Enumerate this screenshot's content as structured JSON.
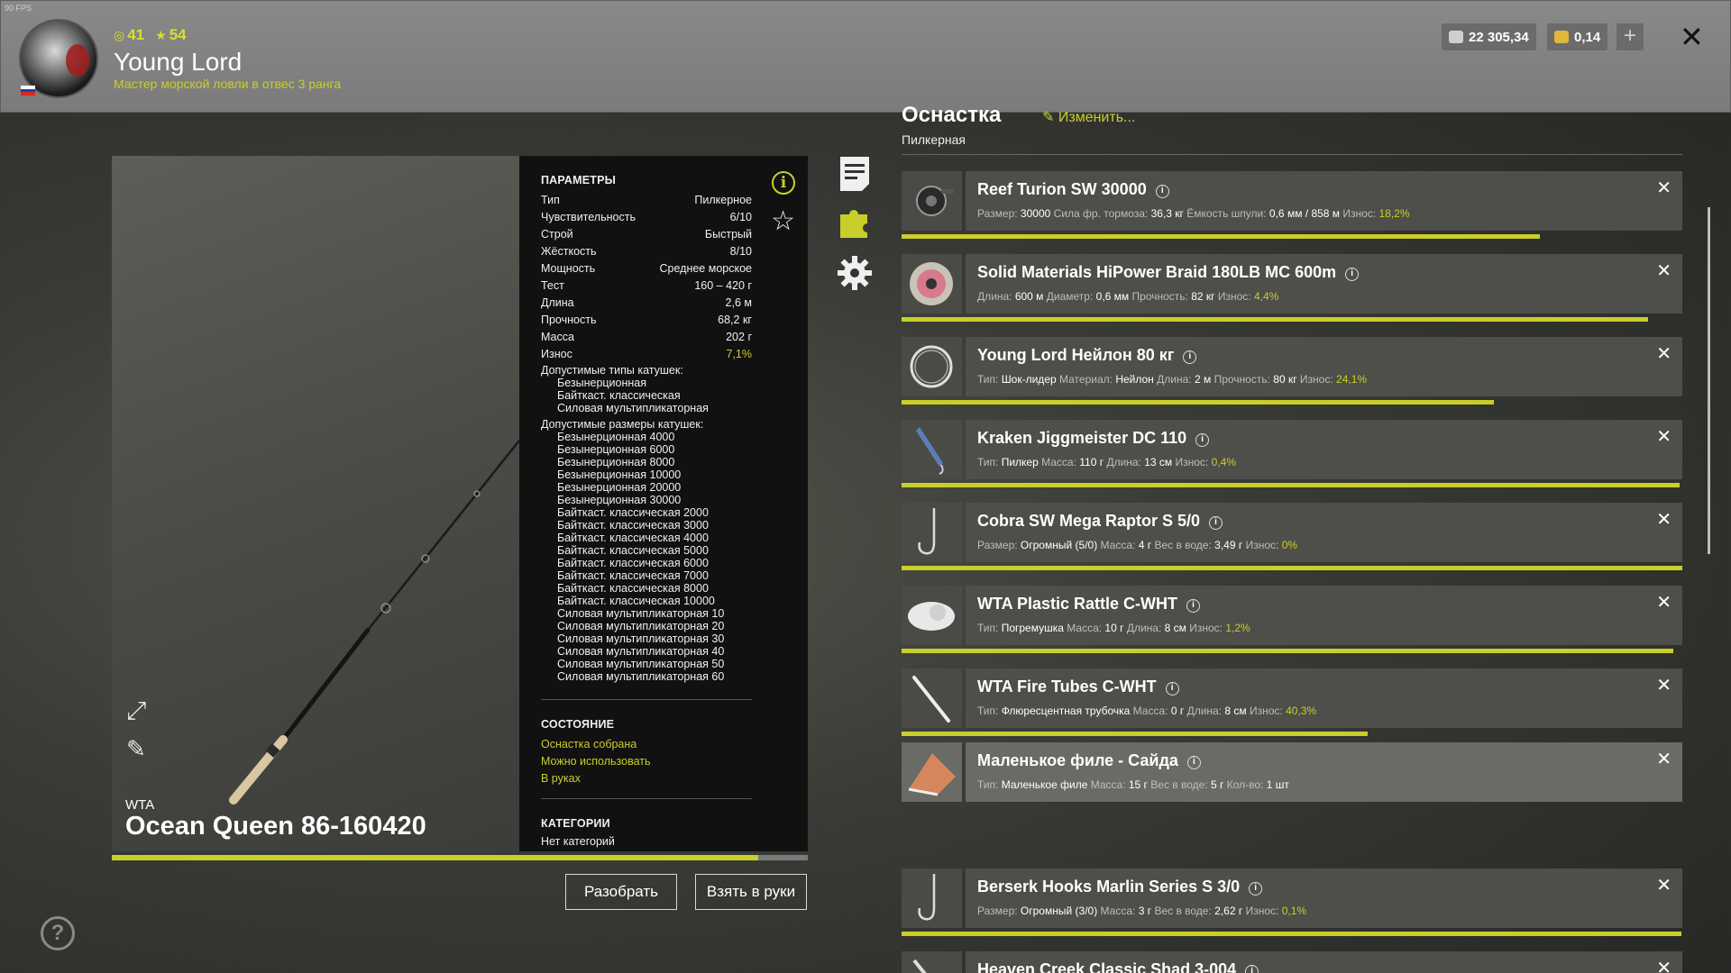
{
  "fps": "90 FPS",
  "colors": {
    "accent": "#c8cf2a",
    "header_bg": "#808080"
  },
  "player": {
    "level": "41",
    "stars": "54",
    "name": "Young Lord",
    "rank": "Мастер морской ловли в отвес 3 ранга"
  },
  "currency": {
    "silver": "22 305,34",
    "gold": "0,14"
  },
  "rod": {
    "brand": "WTA",
    "name": "Ocean Queen 86-160420",
    "wear_fraction": 0.929
  },
  "params": {
    "title": "ПАРАМЕТРЫ",
    "rows": [
      {
        "label": "Тип",
        "value": "Пилкерное"
      },
      {
        "label": "Чувствительность",
        "value": "6/10"
      },
      {
        "label": "Строй",
        "value": "Быстрый"
      },
      {
        "label": "Жёсткость",
        "value": "8/10"
      },
      {
        "label": "Мощность",
        "value": "Среднее морское"
      },
      {
        "label": "Тест",
        "value": "160 – 420 г"
      },
      {
        "label": "Длина",
        "value": "2,6 м"
      },
      {
        "label": "Прочность",
        "value": "68,2 кг"
      },
      {
        "label": "Масса",
        "value": "202 г"
      },
      {
        "label": "Износ",
        "value": "7,1%"
      }
    ],
    "reel_types_title": "Допустимые типы катушек:",
    "reel_types": [
      "Безынерционная",
      "Байткаст. классическая",
      "Силовая мультипликаторная"
    ],
    "reel_sizes_title": "Допустимые размеры катушек:",
    "reel_sizes": [
      "Безынерционная 4000",
      "Безынерционная 6000",
      "Безынерционная 8000",
      "Безынерционная 10000",
      "Безынерционная 20000",
      "Безынерционная 30000",
      "Байткаст. классическая 2000",
      "Байткаст. классическая 3000",
      "Байткаст. классическая 4000",
      "Байткаст. классическая 5000",
      "Байткаст. классическая 6000",
      "Байткаст. классическая 7000",
      "Байткаст. классическая 8000",
      "Байткаст. классическая 10000",
      "Силовая мультипликаторная 10",
      "Силовая мультипликаторная 20",
      "Силовая мультипликаторная 30",
      "Силовая мультипликаторная 40",
      "Силовая мультипликаторная 50",
      "Силовая мультипликаторная 60"
    ],
    "state_title": "СОСТОЯНИЕ",
    "states": [
      "Оснастка собрана",
      "Можно использовать",
      "В руках"
    ],
    "categories_title": "КАТЕГОРИИ",
    "categories_value": "Нет категорий"
  },
  "buttons": {
    "disassemble": "Разобрать",
    "take": "Взять в руки"
  },
  "tackle": {
    "title": "Оснастка",
    "edit": "Изменить...",
    "type": "Пилкерная",
    "items": [
      {
        "name": "Reef Turion SW 30000",
        "specs": [
          [
            "Размер:",
            "30000"
          ],
          [
            "Сила фр. тормоза:",
            "36,3 кг"
          ],
          [
            "Ёмкость шпули:",
            "0,6 мм / 858 м"
          ]
        ],
        "wear_label": "Износ:",
        "wear": "18,2%",
        "bar": 0.818,
        "thumb": "reel-icon"
      },
      {
        "name": "Solid Materials HiPower Braid 180LB MC 600m",
        "specs": [
          [
            "Длина:",
            "600 м"
          ],
          [
            "Диаметр:",
            "0,6 мм"
          ],
          [
            "Прочность:",
            "82 кг"
          ]
        ],
        "wear_label": "Износ:",
        "wear": "4,4%",
        "bar": 0.956,
        "thumb": "line-spool-icon"
      },
      {
        "name": "Young Lord Нейлон 80 кг",
        "specs": [
          [
            "Тип:",
            "Шок-лидер"
          ],
          [
            "Материал:",
            "Нейлон"
          ],
          [
            "Длина:",
            "2 м"
          ],
          [
            "Прочность:",
            "80 кг"
          ]
        ],
        "wear_label": "Износ:",
        "wear": "24,1%",
        "bar": 0.759,
        "thumb": "leader-coil-icon"
      },
      {
        "name": "Kraken Jiggmeister DC 110",
        "specs": [
          [
            "Тип:",
            "Пилкер"
          ],
          [
            "Масса:",
            "110 г"
          ],
          [
            "Длина:",
            "13 см"
          ]
        ],
        "wear_label": "Износ:",
        "wear": "0,4%",
        "bar": 0.996,
        "thumb": "jig-lure-icon"
      },
      {
        "name": "Cobra SW Mega Raptor S 5/0",
        "specs": [
          [
            "Размер:",
            "Огромный (5/0)"
          ],
          [
            "Масса:",
            "4 г"
          ],
          [
            "Вес в воде:",
            "3,49 г"
          ]
        ],
        "wear_label": "Износ:",
        "wear": "0%",
        "bar": 1.0,
        "thumb": "hook-icon"
      },
      {
        "name": "WTA Plastic Rattle C-WHT",
        "specs": [
          [
            "Тип:",
            "Погремушка"
          ],
          [
            "Масса:",
            "10 г"
          ],
          [
            "Длина:",
            "8 см"
          ]
        ],
        "wear_label": "Износ:",
        "wear": "1,2%",
        "bar": 0.988,
        "thumb": "rattle-icon"
      },
      {
        "name": "WTA Fire Tubes C-WHT",
        "specs": [
          [
            "Тип:",
            "Флюресцентная трубочка"
          ],
          [
            "Масса:",
            "0 г"
          ],
          [
            "Длина:",
            "8 см"
          ]
        ],
        "wear_label": "Износ:",
        "wear": "40,3%",
        "bar": 0.597,
        "thumb": "tube-icon"
      },
      {
        "name": "Маленькое филе - Сайда",
        "specs": [
          [
            "Тип:",
            "Маленькое филе"
          ],
          [
            "Масса:",
            "15 г"
          ],
          [
            "Вес в воде:",
            "5 г"
          ],
          [
            "Кол-во:",
            "1 шт"
          ]
        ],
        "wear_label": "",
        "wear": "",
        "bar": null,
        "thumb": "fillet-bait-icon"
      },
      {
        "name": "Berserk Hooks Marlin Series S 3/0",
        "specs": [
          [
            "Размер:",
            "Огромный (3/0)"
          ],
          [
            "Масса:",
            "3 г"
          ],
          [
            "Вес в воде:",
            "2,62 г"
          ]
        ],
        "wear_label": "Износ:",
        "wear": "0,1%",
        "bar": 0.999,
        "thumb": "hook-icon"
      },
      {
        "name": "Heaven Creek Classic Shad 3-004",
        "specs": [],
        "wear_label": "",
        "wear": "",
        "bar": null,
        "thumb": "shad-lure-icon"
      }
    ]
  }
}
